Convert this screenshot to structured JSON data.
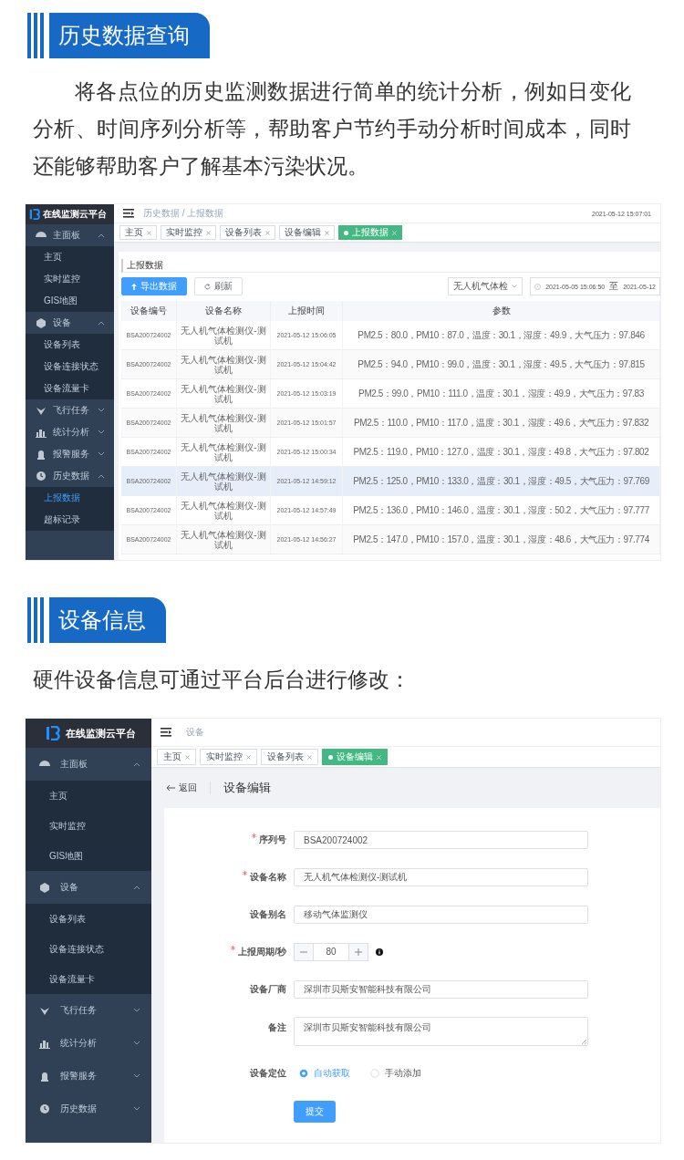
{
  "history_section": {
    "heading": "历史数据查询",
    "paragraph": "将各点位的历史监测数据进行简单的统计分析，例如日变化分析、时间序列分析等，帮助客户节约手动分析时间成本，同时还能够帮助客户了解基本污染状况。",
    "app": {
      "sidebar": {
        "title": "在线监测云平台",
        "groups": [
          {
            "label": "主面板",
            "expanded": true,
            "children": [
              {
                "label": "主页",
                "selected": false
              },
              {
                "label": "实时监控",
                "selected": false
              },
              {
                "label": "GIS地图",
                "selected": false
              }
            ]
          },
          {
            "label": "设备",
            "expanded": true,
            "children": [
              {
                "label": "设备列表",
                "selected": false
              },
              {
                "label": "设备连接状态",
                "selected": false
              },
              {
                "label": "设备流量卡",
                "selected": false
              }
            ]
          },
          {
            "label": "飞行任务",
            "expanded": false
          },
          {
            "label": "统计分析",
            "expanded": false
          },
          {
            "label": "报警服务",
            "expanded": false
          },
          {
            "label": "历史数据",
            "expanded": true,
            "children": [
              {
                "label": "上报数据",
                "selected": true
              },
              {
                "label": "超标记录",
                "selected": false
              }
            ]
          }
        ]
      },
      "breadcrumb": "历史数据 / 上报数据",
      "time": "2021-05-12 15:07:01",
      "tabs": [
        {
          "label": "主页",
          "selected": false
        },
        {
          "label": "实时监控",
          "selected": false
        },
        {
          "label": "设备列表",
          "selected": false
        },
        {
          "label": "设备编辑",
          "selected": false
        },
        {
          "label": "上报数据",
          "selected": true
        }
      ],
      "card_title": "上报数据",
      "buttons": [
        {
          "label": "导出数据",
          "kind": "primary"
        },
        {
          "label": "刷新",
          "kind": "plain"
        }
      ],
      "device_select": "无人机气体检",
      "date_range": {
        "start": "2021-05-05 15:06:50",
        "separator": "至",
        "end": "2021-05-12"
      },
      "table": {
        "columns": [
          "设备编号",
          "设备名称",
          "上报时间",
          "参数"
        ],
        "rows": [
          {
            "hovered": false,
            "cells": [
              "BSA200724002",
              "无人机气体检测仪-测试机",
              "2021-05-12 15:06:05",
              "PM2.5：80.0，PM10：87.0，温度：30.1，湿度：49.9，大气压力：97.846"
            ]
          },
          {
            "hovered": false,
            "cells": [
              "BSA200724002",
              "无人机气体检测仪-测试机",
              "2021-05-12 15:04:42",
              "PM2.5：94.0，PM10：99.0，温度：30.1，湿度：49.5，大气压力：97.815"
            ]
          },
          {
            "hovered": false,
            "cells": [
              "BSA200724002",
              "无人机气体检测仪-测试机",
              "2021-05-12 15:03:19",
              "PM2.5：99.0，PM10：111.0，温度：30.1，湿度：49.9，大气压力：97.83"
            ]
          },
          {
            "hovered": false,
            "cells": [
              "BSA200724002",
              "无人机气体检测仪-测试机",
              "2021-05-12 15:01:57",
              "PM2.5：110.0，PM10：117.0，温度：30.1，湿度：49.6，大气压力：97.832"
            ]
          },
          {
            "hovered": false,
            "cells": [
              "BSA200724002",
              "无人机气体检测仪-测试机",
              "2021-05-12 15:00:34",
              "PM2.5：119.0，PM10：127.0，温度：30.1，湿度：49.8，大气压力：97.802"
            ]
          },
          {
            "hovered": true,
            "cells": [
              "BSA200724002",
              "无人机气体检测仪-测试机",
              "2021-05-12 14:59:12",
              "PM2.5：125.0，PM10：133.0，温度：30.1，湿度：49.5，大气压力：97.769"
            ]
          },
          {
            "hovered": false,
            "cells": [
              "BSA200724002",
              "无人机气体检测仪-测试机",
              "2021-05-12 14:57:49",
              "PM2.5：136.0，PM10：146.0，温度：30.1，湿度：50.2，大气压力：97.777"
            ]
          },
          {
            "hovered": false,
            "cells": [
              "BSA200724002",
              "无人机气体检测仪-测试机",
              "2021-05-12 14:56:27",
              "PM2.5：147.0，PM10：157.0，温度：30.1，湿度：48.6，大气压力：97.774"
            ]
          }
        ]
      }
    }
  },
  "device_section": {
    "heading": "设备信息",
    "intro": "硬件设备信息可通过平台后台进行修改：",
    "app": {
      "sidebar": {
        "title": "在线监测云平台",
        "groups": [
          {
            "label": "主面板",
            "expanded": true,
            "children": [
              {
                "label": "主页",
                "selected": false
              },
              {
                "label": "实时监控",
                "selected": false
              },
              {
                "label": "GIS地图",
                "selected": false
              }
            ]
          },
          {
            "label": "设备",
            "expanded": true,
            "children": [
              {
                "label": "设备列表",
                "selected": false
              },
              {
                "label": "设备连接状态",
                "selected": false
              },
              {
                "label": "设备流量卡",
                "selected": false
              }
            ]
          },
          {
            "label": "飞行任务",
            "expanded": false
          },
          {
            "label": "统计分析",
            "expanded": false
          },
          {
            "label": "报警服务",
            "expanded": false
          },
          {
            "label": "历史数据",
            "expanded": false
          }
        ]
      },
      "breadcrumb": "设备",
      "tabs": [
        {
          "label": "主页",
          "selected": false
        },
        {
          "label": "实时监控",
          "selected": false
        },
        {
          "label": "设备列表",
          "selected": false
        },
        {
          "label": "设备编辑",
          "selected": true
        }
      ],
      "back": "返回",
      "page_title": "设备编辑",
      "form": {
        "fields": [
          {
            "kind": "text",
            "label": "序列号",
            "required": true,
            "value": "BSA200724002"
          },
          {
            "kind": "text",
            "label": "设备名称",
            "required": true,
            "value": "无人机气体检测仪-测试机"
          },
          {
            "kind": "text",
            "label": "设备别名",
            "required": false,
            "value": "移动气体监测仪"
          },
          {
            "kind": "number",
            "label": "上报周期/秒",
            "required": true,
            "value": "80"
          },
          {
            "kind": "text",
            "label": "设备厂商",
            "required": false,
            "value": "深圳市贝斯安智能科技有限公司"
          },
          {
            "kind": "textarea",
            "label": "备注",
            "required": false,
            "value": "深圳市贝斯安智能科技有限公司"
          },
          {
            "kind": "radio",
            "label": "设备定位",
            "required": false,
            "options": [
              {
                "label": "自动获取",
                "selected": true
              },
              {
                "label": "手动添加",
                "selected": false
              }
            ]
          }
        ],
        "submit": "提交"
      }
    }
  }
}
